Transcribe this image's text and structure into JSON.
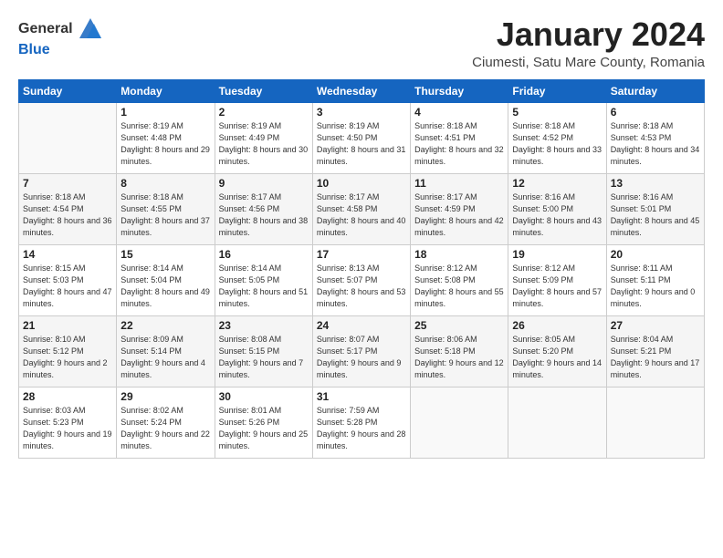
{
  "logo": {
    "general": "General",
    "blue": "Blue"
  },
  "title": "January 2024",
  "location": "Ciumesti, Satu Mare County, Romania",
  "days_header": [
    "Sunday",
    "Monday",
    "Tuesday",
    "Wednesday",
    "Thursday",
    "Friday",
    "Saturday"
  ],
  "weeks": [
    [
      {
        "day": "",
        "sunrise": "",
        "sunset": "",
        "daylight": ""
      },
      {
        "day": "1",
        "sunrise": "8:19 AM",
        "sunset": "4:48 PM",
        "daylight": "8 hours and 29 minutes."
      },
      {
        "day": "2",
        "sunrise": "8:19 AM",
        "sunset": "4:49 PM",
        "daylight": "8 hours and 30 minutes."
      },
      {
        "day": "3",
        "sunrise": "8:19 AM",
        "sunset": "4:50 PM",
        "daylight": "8 hours and 31 minutes."
      },
      {
        "day": "4",
        "sunrise": "8:18 AM",
        "sunset": "4:51 PM",
        "daylight": "8 hours and 32 minutes."
      },
      {
        "day": "5",
        "sunrise": "8:18 AM",
        "sunset": "4:52 PM",
        "daylight": "8 hours and 33 minutes."
      },
      {
        "day": "6",
        "sunrise": "8:18 AM",
        "sunset": "4:53 PM",
        "daylight": "8 hours and 34 minutes."
      }
    ],
    [
      {
        "day": "7",
        "sunrise": "8:18 AM",
        "sunset": "4:54 PM",
        "daylight": "8 hours and 36 minutes."
      },
      {
        "day": "8",
        "sunrise": "8:18 AM",
        "sunset": "4:55 PM",
        "daylight": "8 hours and 37 minutes."
      },
      {
        "day": "9",
        "sunrise": "8:17 AM",
        "sunset": "4:56 PM",
        "daylight": "8 hours and 38 minutes."
      },
      {
        "day": "10",
        "sunrise": "8:17 AM",
        "sunset": "4:58 PM",
        "daylight": "8 hours and 40 minutes."
      },
      {
        "day": "11",
        "sunrise": "8:17 AM",
        "sunset": "4:59 PM",
        "daylight": "8 hours and 42 minutes."
      },
      {
        "day": "12",
        "sunrise": "8:16 AM",
        "sunset": "5:00 PM",
        "daylight": "8 hours and 43 minutes."
      },
      {
        "day": "13",
        "sunrise": "8:16 AM",
        "sunset": "5:01 PM",
        "daylight": "8 hours and 45 minutes."
      }
    ],
    [
      {
        "day": "14",
        "sunrise": "8:15 AM",
        "sunset": "5:03 PM",
        "daylight": "8 hours and 47 minutes."
      },
      {
        "day": "15",
        "sunrise": "8:14 AM",
        "sunset": "5:04 PM",
        "daylight": "8 hours and 49 minutes."
      },
      {
        "day": "16",
        "sunrise": "8:14 AM",
        "sunset": "5:05 PM",
        "daylight": "8 hours and 51 minutes."
      },
      {
        "day": "17",
        "sunrise": "8:13 AM",
        "sunset": "5:07 PM",
        "daylight": "8 hours and 53 minutes."
      },
      {
        "day": "18",
        "sunrise": "8:12 AM",
        "sunset": "5:08 PM",
        "daylight": "8 hours and 55 minutes."
      },
      {
        "day": "19",
        "sunrise": "8:12 AM",
        "sunset": "5:09 PM",
        "daylight": "8 hours and 57 minutes."
      },
      {
        "day": "20",
        "sunrise": "8:11 AM",
        "sunset": "5:11 PM",
        "daylight": "9 hours and 0 minutes."
      }
    ],
    [
      {
        "day": "21",
        "sunrise": "8:10 AM",
        "sunset": "5:12 PM",
        "daylight": "9 hours and 2 minutes."
      },
      {
        "day": "22",
        "sunrise": "8:09 AM",
        "sunset": "5:14 PM",
        "daylight": "9 hours and 4 minutes."
      },
      {
        "day": "23",
        "sunrise": "8:08 AM",
        "sunset": "5:15 PM",
        "daylight": "9 hours and 7 minutes."
      },
      {
        "day": "24",
        "sunrise": "8:07 AM",
        "sunset": "5:17 PM",
        "daylight": "9 hours and 9 minutes."
      },
      {
        "day": "25",
        "sunrise": "8:06 AM",
        "sunset": "5:18 PM",
        "daylight": "9 hours and 12 minutes."
      },
      {
        "day": "26",
        "sunrise": "8:05 AM",
        "sunset": "5:20 PM",
        "daylight": "9 hours and 14 minutes."
      },
      {
        "day": "27",
        "sunrise": "8:04 AM",
        "sunset": "5:21 PM",
        "daylight": "9 hours and 17 minutes."
      }
    ],
    [
      {
        "day": "28",
        "sunrise": "8:03 AM",
        "sunset": "5:23 PM",
        "daylight": "9 hours and 19 minutes."
      },
      {
        "day": "29",
        "sunrise": "8:02 AM",
        "sunset": "5:24 PM",
        "daylight": "9 hours and 22 minutes."
      },
      {
        "day": "30",
        "sunrise": "8:01 AM",
        "sunset": "5:26 PM",
        "daylight": "9 hours and 25 minutes."
      },
      {
        "day": "31",
        "sunrise": "7:59 AM",
        "sunset": "5:28 PM",
        "daylight": "9 hours and 28 minutes."
      },
      {
        "day": "",
        "sunrise": "",
        "sunset": "",
        "daylight": ""
      },
      {
        "day": "",
        "sunrise": "",
        "sunset": "",
        "daylight": ""
      },
      {
        "day": "",
        "sunrise": "",
        "sunset": "",
        "daylight": ""
      }
    ]
  ]
}
